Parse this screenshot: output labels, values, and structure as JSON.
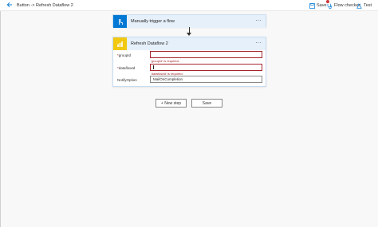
{
  "header": {
    "breadcrumb": "Button -> Refresh Dataflow 2",
    "save_label": "Save",
    "flow_checker_label": "Flow checker",
    "test_label": "Test"
  },
  "trigger_card": {
    "title": "Manually trigger a flow",
    "more": "···"
  },
  "action_card": {
    "title": "Refresh Dataflow 2",
    "more": "···",
    "fields": [
      {
        "label": "groupId",
        "value": "",
        "error": "'groupId' is required."
      },
      {
        "label": "dataflowId",
        "value": "",
        "error": "'dataflowId' is required."
      },
      {
        "label": "NotifyOption",
        "value": "MailOnCompletion",
        "error": ""
      }
    ]
  },
  "footer": {
    "new_step_label": "+ New step",
    "save_label": "Save"
  },
  "colors": {
    "accent": "#0078d4",
    "powerbi": "#f2c811",
    "error": "#a4262c"
  },
  "icons": {
    "back": "arrow-left-icon",
    "trigger": "hand-touch-icon",
    "action": "power-bi-icon",
    "save": "save-icon",
    "checker": "stethoscope-icon",
    "test": "flask-icon"
  }
}
